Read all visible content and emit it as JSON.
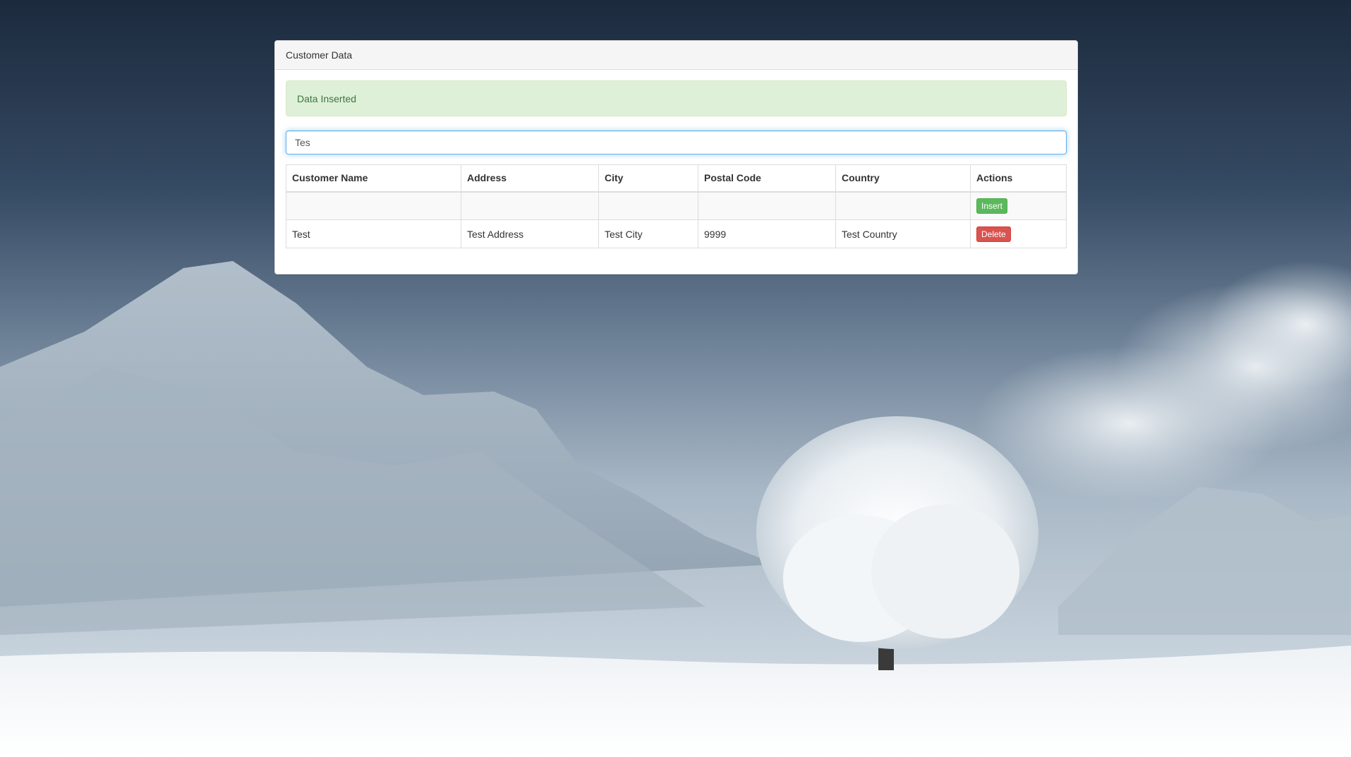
{
  "panel": {
    "title": "Customer Data"
  },
  "alert": {
    "message": "Data Inserted"
  },
  "search": {
    "value": "Tes",
    "placeholder": ""
  },
  "table": {
    "headers": [
      "Customer Name",
      "Address",
      "City",
      "Postal Code",
      "Country",
      "Actions"
    ],
    "insert_button_label": "Insert",
    "rows": [
      {
        "customer_name": "Test",
        "address": "Test Address",
        "city": "Test City",
        "postal_code": "9999",
        "country": "Test Country",
        "action_label": "Delete"
      }
    ]
  },
  "colors": {
    "alert_background": "#dff0d8",
    "alert_text": "#3c763d",
    "insert_button": "#5cb85c",
    "delete_button": "#d9534f",
    "input_focus_border": "#66afe9"
  }
}
